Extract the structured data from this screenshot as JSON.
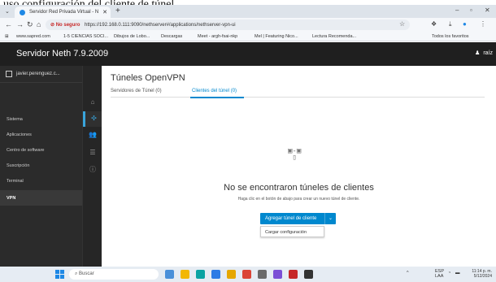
{
  "caption": "uso configuración del cliente de túnel.",
  "browser": {
    "tab_title": "Servidor Red Privada Virtual - N",
    "new_tab": "+",
    "not_secure": "No seguro",
    "url": "https://192.168.0.111:9090/nethserver#/applications/nethserver-vpn-ui",
    "bookmarks": [
      "www.sapred.com",
      "1-5 CIENCIAS SOCI...",
      "Dibujos de Lobo...",
      "Descargas",
      "Meet - argh-fsai-nkp",
      "Mel | Featuring Nico...",
      "Lectura Recomenda...",
      "Todos los favoritos"
    ]
  },
  "app": {
    "title": "Servidor Neth 7.9.2009",
    "user": "raíz"
  },
  "sidebar": {
    "header": "javier.perenguez.c...",
    "items": [
      {
        "label": "Sistema"
      },
      {
        "label": "Aplicaciones"
      },
      {
        "label": "Centro de software"
      },
      {
        "label": "Suscripción"
      },
      {
        "label": "Terminal"
      },
      {
        "label": "VPN"
      }
    ]
  },
  "main": {
    "title": "Túneles OpenVPN",
    "tabs": [
      {
        "label": "Servidores de Túnel (0)"
      },
      {
        "label": "Clientes del túnel (0)"
      }
    ],
    "empty_icon": "▯-▯\n▯",
    "empty_title": "No se encontraron túneles de clientes",
    "empty_subtitle": "Haga clic en el botón de abajo para crear un nuevo túnel de cliente.",
    "add_button": "Agregar túnel de cliente",
    "dropdown_item": "Cargar configuración"
  },
  "taskbar": {
    "search_placeholder": "Buscar",
    "lang": "ESP",
    "lang2": "LAA",
    "time": "11:14 p. m.",
    "date": "5/12/2024"
  }
}
